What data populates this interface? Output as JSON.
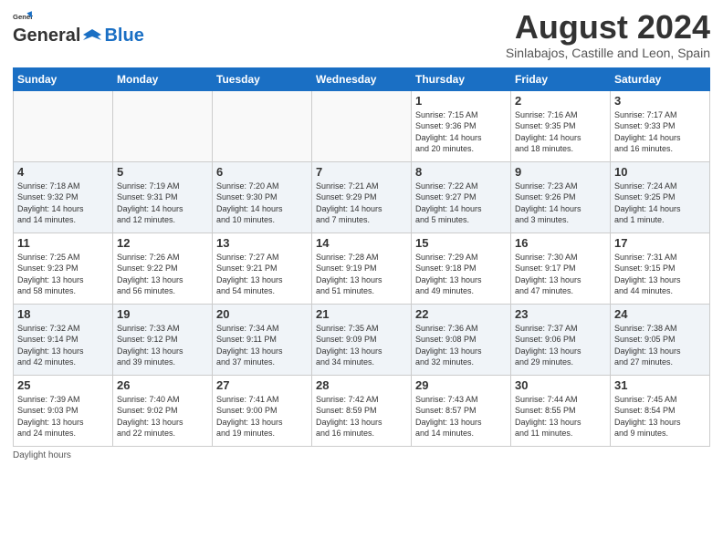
{
  "logo": {
    "text_general": "General",
    "text_blue": "Blue"
  },
  "header": {
    "title": "August 2024",
    "subtitle": "Sinlabajos, Castille and Leon, Spain"
  },
  "days_of_week": [
    "Sunday",
    "Monday",
    "Tuesday",
    "Wednesday",
    "Thursday",
    "Friday",
    "Saturday"
  ],
  "weeks": [
    [
      {
        "day": "",
        "info": ""
      },
      {
        "day": "",
        "info": ""
      },
      {
        "day": "",
        "info": ""
      },
      {
        "day": "",
        "info": ""
      },
      {
        "day": "1",
        "info": "Sunrise: 7:15 AM\nSunset: 9:36 PM\nDaylight: 14 hours\nand 20 minutes."
      },
      {
        "day": "2",
        "info": "Sunrise: 7:16 AM\nSunset: 9:35 PM\nDaylight: 14 hours\nand 18 minutes."
      },
      {
        "day": "3",
        "info": "Sunrise: 7:17 AM\nSunset: 9:33 PM\nDaylight: 14 hours\nand 16 minutes."
      }
    ],
    [
      {
        "day": "4",
        "info": "Sunrise: 7:18 AM\nSunset: 9:32 PM\nDaylight: 14 hours\nand 14 minutes."
      },
      {
        "day": "5",
        "info": "Sunrise: 7:19 AM\nSunset: 9:31 PM\nDaylight: 14 hours\nand 12 minutes."
      },
      {
        "day": "6",
        "info": "Sunrise: 7:20 AM\nSunset: 9:30 PM\nDaylight: 14 hours\nand 10 minutes."
      },
      {
        "day": "7",
        "info": "Sunrise: 7:21 AM\nSunset: 9:29 PM\nDaylight: 14 hours\nand 7 minutes."
      },
      {
        "day": "8",
        "info": "Sunrise: 7:22 AM\nSunset: 9:27 PM\nDaylight: 14 hours\nand 5 minutes."
      },
      {
        "day": "9",
        "info": "Sunrise: 7:23 AM\nSunset: 9:26 PM\nDaylight: 14 hours\nand 3 minutes."
      },
      {
        "day": "10",
        "info": "Sunrise: 7:24 AM\nSunset: 9:25 PM\nDaylight: 14 hours\nand 1 minute."
      }
    ],
    [
      {
        "day": "11",
        "info": "Sunrise: 7:25 AM\nSunset: 9:23 PM\nDaylight: 13 hours\nand 58 minutes."
      },
      {
        "day": "12",
        "info": "Sunrise: 7:26 AM\nSunset: 9:22 PM\nDaylight: 13 hours\nand 56 minutes."
      },
      {
        "day": "13",
        "info": "Sunrise: 7:27 AM\nSunset: 9:21 PM\nDaylight: 13 hours\nand 54 minutes."
      },
      {
        "day": "14",
        "info": "Sunrise: 7:28 AM\nSunset: 9:19 PM\nDaylight: 13 hours\nand 51 minutes."
      },
      {
        "day": "15",
        "info": "Sunrise: 7:29 AM\nSunset: 9:18 PM\nDaylight: 13 hours\nand 49 minutes."
      },
      {
        "day": "16",
        "info": "Sunrise: 7:30 AM\nSunset: 9:17 PM\nDaylight: 13 hours\nand 47 minutes."
      },
      {
        "day": "17",
        "info": "Sunrise: 7:31 AM\nSunset: 9:15 PM\nDaylight: 13 hours\nand 44 minutes."
      }
    ],
    [
      {
        "day": "18",
        "info": "Sunrise: 7:32 AM\nSunset: 9:14 PM\nDaylight: 13 hours\nand 42 minutes."
      },
      {
        "day": "19",
        "info": "Sunrise: 7:33 AM\nSunset: 9:12 PM\nDaylight: 13 hours\nand 39 minutes."
      },
      {
        "day": "20",
        "info": "Sunrise: 7:34 AM\nSunset: 9:11 PM\nDaylight: 13 hours\nand 37 minutes."
      },
      {
        "day": "21",
        "info": "Sunrise: 7:35 AM\nSunset: 9:09 PM\nDaylight: 13 hours\nand 34 minutes."
      },
      {
        "day": "22",
        "info": "Sunrise: 7:36 AM\nSunset: 9:08 PM\nDaylight: 13 hours\nand 32 minutes."
      },
      {
        "day": "23",
        "info": "Sunrise: 7:37 AM\nSunset: 9:06 PM\nDaylight: 13 hours\nand 29 minutes."
      },
      {
        "day": "24",
        "info": "Sunrise: 7:38 AM\nSunset: 9:05 PM\nDaylight: 13 hours\nand 27 minutes."
      }
    ],
    [
      {
        "day": "25",
        "info": "Sunrise: 7:39 AM\nSunset: 9:03 PM\nDaylight: 13 hours\nand 24 minutes."
      },
      {
        "day": "26",
        "info": "Sunrise: 7:40 AM\nSunset: 9:02 PM\nDaylight: 13 hours\nand 22 minutes."
      },
      {
        "day": "27",
        "info": "Sunrise: 7:41 AM\nSunset: 9:00 PM\nDaylight: 13 hours\nand 19 minutes."
      },
      {
        "day": "28",
        "info": "Sunrise: 7:42 AM\nSunset: 8:59 PM\nDaylight: 13 hours\nand 16 minutes."
      },
      {
        "day": "29",
        "info": "Sunrise: 7:43 AM\nSunset: 8:57 PM\nDaylight: 13 hours\nand 14 minutes."
      },
      {
        "day": "30",
        "info": "Sunrise: 7:44 AM\nSunset: 8:55 PM\nDaylight: 13 hours\nand 11 minutes."
      },
      {
        "day": "31",
        "info": "Sunrise: 7:45 AM\nSunset: 8:54 PM\nDaylight: 13 hours\nand 9 minutes."
      }
    ]
  ],
  "footer": {
    "note": "Daylight hours"
  },
  "colors": {
    "header_bg": "#1a6fc4",
    "accent": "#1a6fc4"
  }
}
